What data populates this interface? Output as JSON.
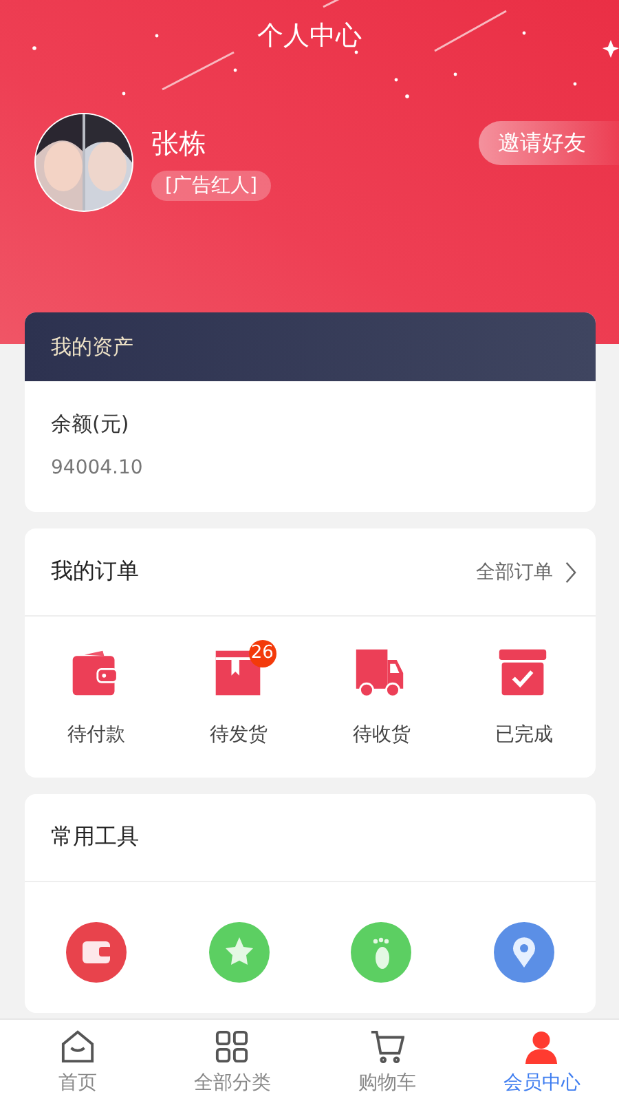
{
  "header": {
    "title": "个人中心"
  },
  "profile": {
    "name": "张栋",
    "tag": "[广告红人]",
    "invite_button": "邀请好友"
  },
  "assets": {
    "title": "我的资产",
    "balance_label": "余额(元)",
    "balance_value": "94004.10"
  },
  "orders": {
    "title": "我的订单",
    "all_link": "全部订单",
    "items": [
      {
        "label": "待付款"
      },
      {
        "label": "待发货",
        "badge": "26"
      },
      {
        "label": "待收货"
      },
      {
        "label": "已完成"
      }
    ]
  },
  "tools": {
    "title": "常用工具",
    "items": [
      {
        "color": "#e8434c"
      },
      {
        "color": "#5ccf62"
      },
      {
        "color": "#5ccf62"
      },
      {
        "color": "#5b8fe6"
      }
    ]
  },
  "tabbar": [
    {
      "label": "首页",
      "selected": false
    },
    {
      "label": "全部分类",
      "selected": false
    },
    {
      "label": "购物车",
      "selected": false
    },
    {
      "label": "会员中心",
      "selected": true
    }
  ]
}
